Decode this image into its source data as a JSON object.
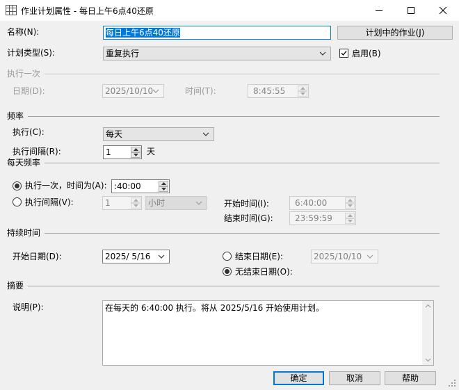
{
  "window": {
    "title": "作业计划属性 - 每日上午6点40还原",
    "icon": "calendar-grid-icon",
    "controls": [
      "minimize-icon",
      "maximize-icon",
      "close-icon"
    ]
  },
  "name": {
    "label": "名称(N):",
    "value": "每日上午6点40还原",
    "jobs_button": "计划中的作业(J)"
  },
  "schedule_type": {
    "label": "计划类型(S):",
    "value": "重复执行",
    "enabled_label": "启用(B)",
    "enabled": true
  },
  "one_time": {
    "section": "执行一次",
    "date_label": "日期(D):",
    "date_value": "2025/10/10",
    "time_label": "时间(T):",
    "time_value": "8:45:55"
  },
  "frequency": {
    "section": "频率",
    "occurs_label": "执行(C):",
    "occurs_value": "每天",
    "interval_label": "执行间隔(R):",
    "interval_value": "1",
    "interval_unit": "天"
  },
  "daily_frequency": {
    "section": "每天频率",
    "once_label": "执行一次，时间为(A):",
    "once_value": ":40:00",
    "once_checked": true,
    "every_label": "执行间隔(V):",
    "every_value": "1",
    "every_unit": "小时",
    "every_checked": false,
    "start_label": "开始时间(I):",
    "start_value": "6:40:00",
    "end_label": "结束时间(G):",
    "end_value": "23:59:59"
  },
  "duration": {
    "section": "持续时间",
    "start_date_label": "开始日期(D):",
    "start_date_value": "2025/ 5/16",
    "end_date_label": "结束日期(E):",
    "end_date_value": "2025/10/10",
    "end_date_checked": false,
    "no_end_label": "无结束日期(O):",
    "no_end_checked": true
  },
  "summary": {
    "section": "摘要",
    "desc_label": "说明(P):",
    "desc_value": "在每天的 6:40:00 执行。将从 2025/5/16 开始使用计划。"
  },
  "buttons": {
    "ok": "确定",
    "cancel": "取消",
    "help": "帮助"
  },
  "colors": {
    "accent": "#0078d7",
    "dialog_bg": "#f0f0f0",
    "disabled_text": "#9a9a9a"
  }
}
